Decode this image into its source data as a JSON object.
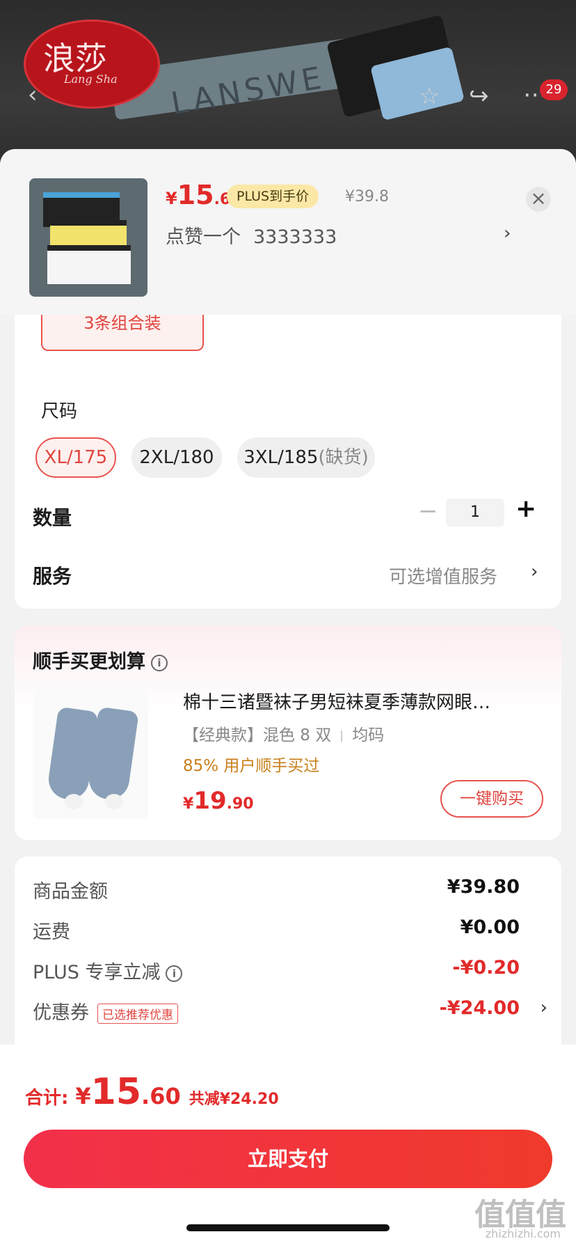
{
  "hero": {
    "brand_logo_text": "浪莎",
    "brand_logo_sub": "Lang Sha",
    "band_text": "LANSWE",
    "cart_badge": "29"
  },
  "sheet": {
    "price_yen": "¥",
    "price_int": "15",
    "price_dec": ".6",
    "plus_tag": "PLUS到手价",
    "old_price": "¥39.8",
    "close_symbol": "×",
    "like_text": "点赞一个",
    "like_number": "3333333",
    "like_chevron": "›"
  },
  "options": {
    "combo_label": "3条组合装",
    "size_label": "尺码",
    "sizes": [
      {
        "label": "XL/175",
        "note": ""
      },
      {
        "label": "2XL/180",
        "note": ""
      },
      {
        "label": "3XL/185",
        "note": "(缺货)"
      }
    ],
    "qty_label": "数量",
    "qty_minus": "−",
    "qty_value": "1",
    "qty_plus": "+",
    "service_label": "服务",
    "service_value": "可选增值服务",
    "service_chevron": "›"
  },
  "bundle": {
    "title": "顺手买更划算",
    "info_icon": "i",
    "product_name": "棉十三诸暨袜子男短袜夏季薄款网眼…",
    "spec_style": "【经典款】混色 8 双",
    "spec_size": "均码",
    "buyers": "85% 用户顺手买过",
    "price_yen": "¥",
    "price_int": "19",
    "price_dec": ".90",
    "buy_button": "一键购买"
  },
  "summary": {
    "rows": [
      {
        "label": "商品金额",
        "value": "¥39.80",
        "tag": "",
        "red": false,
        "chevron": ""
      },
      {
        "label": "运费",
        "value": "¥0.00",
        "tag": "",
        "red": false,
        "chevron": ""
      },
      {
        "label": "PLUS 专享立减",
        "value": "-¥0.20",
        "tag": "",
        "red": true,
        "chevron": ""
      },
      {
        "label": "优惠券",
        "value": "-¥24.00",
        "tag": "已选推荐优惠",
        "red": true,
        "chevron": "›"
      }
    ]
  },
  "footer": {
    "total_label": "合计:",
    "total_yen": "¥",
    "total_int": "15",
    "total_dec": ".60",
    "total_cut": "共减¥24.20",
    "pay_button": "立即支付",
    "watermark": "值值值",
    "watermark_sub": "zhizhizhi.com"
  },
  "colors": {
    "accent_red": "#e22a2a",
    "pay_gradient_start": "#f2304a",
    "pay_gradient_end": "#f03a2c",
    "plus_tag_bg": "#fbe8a6",
    "buyers_orange": "#c9801b"
  }
}
